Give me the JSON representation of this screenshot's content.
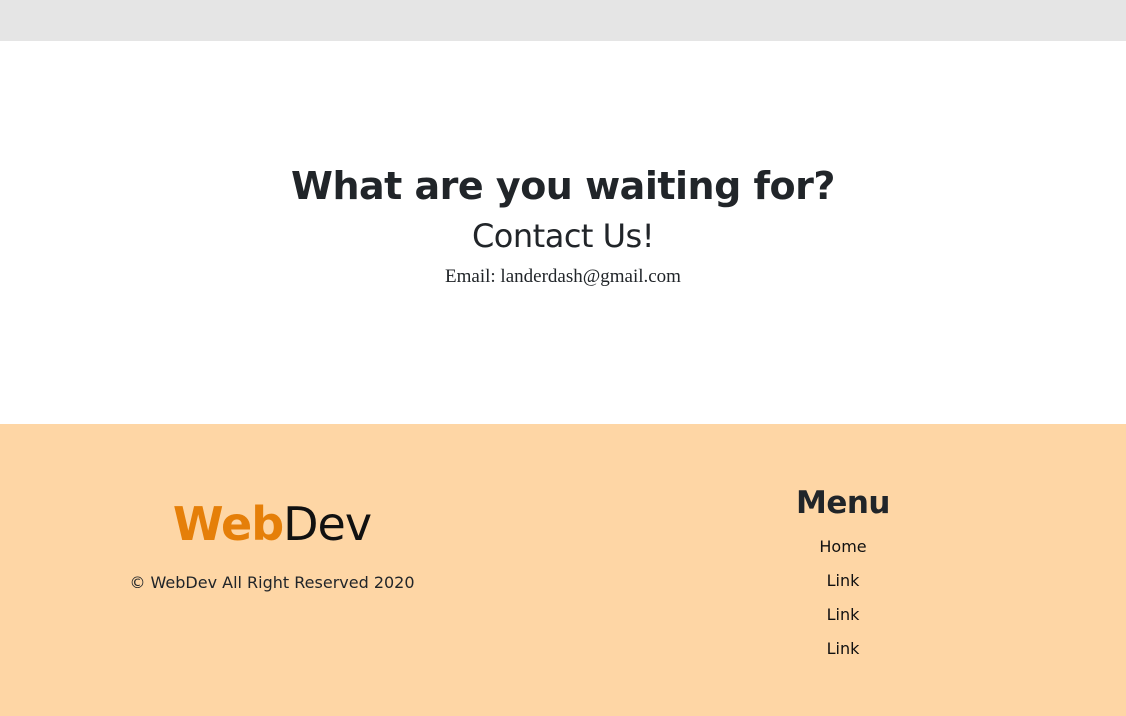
{
  "cta": {
    "heading": "What are you waiting for?",
    "subheading": "Contact Us!",
    "email": "Email: landerdash@gmail.com"
  },
  "footer": {
    "brand": {
      "part1": "Web",
      "part2": "Dev"
    },
    "copyright": "© WebDev All Right Reserved 2020",
    "menu": {
      "title": "Menu",
      "items": [
        {
          "label": "Home"
        },
        {
          "label": "Link"
        },
        {
          "label": "Link"
        },
        {
          "label": "Link"
        }
      ]
    }
  },
  "colors": {
    "top_band": "#e5e5e5",
    "footer_background": "#fed6a5",
    "brand_accent": "#e57f09",
    "text_dark": "#212529"
  }
}
